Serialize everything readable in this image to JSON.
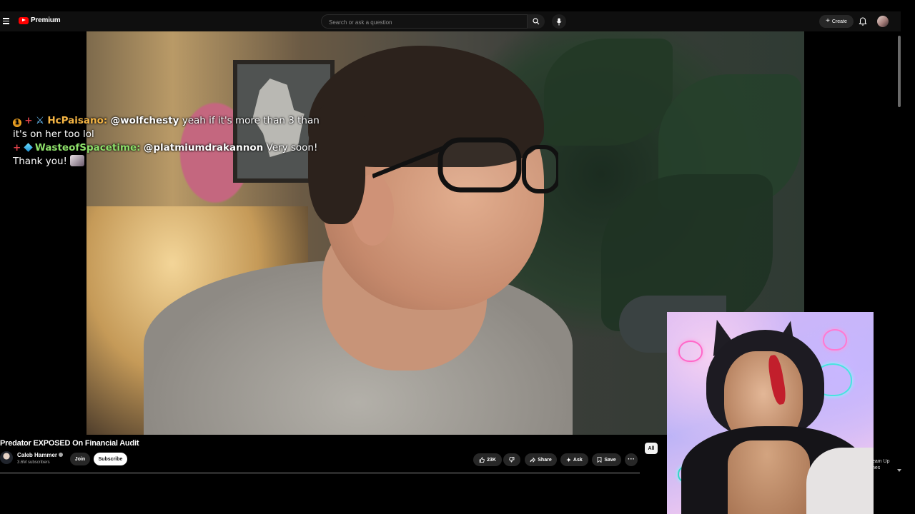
{
  "header": {
    "logo_text": "Premium",
    "search_placeholder": "Search or ask a question",
    "create_label": "Create"
  },
  "chat": [
    {
      "user": "HcPaisano:",
      "mention": "@wolfchesty",
      "text": "yeah if it's more than 3 than it's on her too lol"
    },
    {
      "user": "WasteofSpacetime:",
      "mention": "@platmiumdrakannon",
      "text": "Very soon! Thank you!"
    }
  ],
  "video": {
    "title": "Predator EXPOSED On Financial Audit",
    "channel": "Caleb Hammer",
    "subscribers": "3.6M subscribers",
    "join_label": "Join",
    "subscribe_label": "Subscribe",
    "likes": "23K",
    "share_label": "Share",
    "ask_label": "Ask",
    "save_label": "Save"
  },
  "recommended": {
    "chip_all": "All",
    "partial_text_1": "eam Up",
    "partial_text_2": "nes"
  },
  "colors": {
    "youtube_red": "#ff0000",
    "chat_user1": "#f5b544",
    "chat_user2": "#8ee06a",
    "topbar_bg": "#0f0f0f"
  }
}
